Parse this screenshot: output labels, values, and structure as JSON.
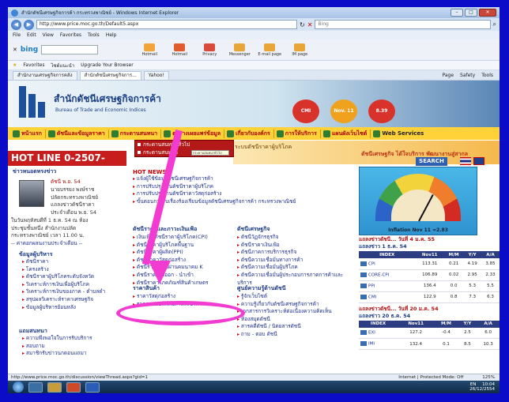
{
  "window": {
    "title": "สำนักดัชนีเศรษฐกิจการค้า กระทรวงพาณิชย์ - Windows Internet Explorer",
    "buttons": {
      "min": "–",
      "max": "□",
      "close": "✕"
    }
  },
  "address": {
    "url": "http://www.price.moc.go.th/Default5.aspx",
    "search_placeholder": "Bing"
  },
  "menu": [
    "File",
    "Edit",
    "View",
    "Favorites",
    "Tools",
    "Help"
  ],
  "bingbar": {
    "label": "bing",
    "tools": [
      "Hotmail",
      "Hotmail",
      "Privacy",
      "Messenger",
      "E-mail page",
      "IM page"
    ]
  },
  "favbar": [
    "Favorites",
    "ไซต์แนะนำ",
    "Upgrade Your Browser"
  ],
  "tabs": [
    "สำนักงานเศรษฐกิจการคลัง",
    "สำนักดัชนีเศรษฐกิจการ...",
    "Yahoo!"
  ],
  "commands": [
    "Page",
    "Safety",
    "Tools"
  ],
  "site": {
    "name_th": "สำนักดัชนีเศรษฐกิจการค้า",
    "name_en": "Bureau of Trade and Economic Indices",
    "circles": [
      "CMI",
      "Nov. 11",
      "8.39"
    ]
  },
  "nav": [
    "หน้าแรก",
    "ดัชนีและข้อมูลราคา",
    "กระดานสนทนา",
    "ตารางเผยแพร่ข้อมูล",
    "เกี่ยวกับองค์กร",
    "การให้บริการ",
    "แผนผังเว็บไซต์",
    "Web Services"
  ],
  "dropdown": [
    "กระดานสนทนาทั่วไป",
    "กระดานสนทนา"
  ],
  "tooltip": "กระดานสนทนาทั่วไป",
  "hotline": "HOT LINE 0-2507-7000",
  "subbanner": {
    "title": "ระบบดัชนีราคาผู้บริโภค",
    "text": "ดัชนีเศรษฐกิจ ได้ใจบริการ พัฒนางานสู่สากล"
  },
  "search_button": "SEARCH",
  "left": {
    "news_title": "ข่าวหนอดทรงข่าว",
    "news_date": "ตัชนี พ.ย. 54",
    "news_lines": [
      "นายบรรยง พงษ์ราช",
      "ปลัดกระทรวงพาณิชย์",
      "แถลงข่าวดัชนีราคา",
      "ประจำเดือน พ.ย. 54",
      "ในวันพฤหัสบดีที่ 1 ธ.ค. 54 ณ ห้อง",
      "ประชุมชั้นหนึ่ง สำนักงานปลัด",
      "กระทรวงพาณิชย์ เวลา 11.00 น.",
      "-- ค่าดอกผลนงานประจำเดือน --"
    ],
    "consumer_title": "ข้อมูลผู้บริหาร",
    "consumer_links": [
      "ดัชนีราคา",
      "โครงสร้าง",
      "ดัชนีราคาผู้บริโภคระดับจังหวัด",
      "วิเคราะห์การเงินเพื่อผู้บริโภค",
      "วิเคราะห์การเงินของภาค - ตำบลดำ",
      "สรุปผลวิเคราะห์ราคาเศรษฐกิจ",
      "ข้อมูลผู้บริหารย้อนหลัง"
    ],
    "board_title": "แถมสนทนา",
    "board_links": [
      "ความพึงพอใจในการรับบริการ",
      "สอบถาม",
      "สมาชิกรับข่าวนกดอนแถมา"
    ]
  },
  "news": {
    "title": "HOT NEWS",
    "items": [
      "แจ้งผู้ใช้ข้อมูลดัชนีเศรษฐกิจการค้า",
      "การปรับปรุงฐานดัชนีราคาผู้บริโภค",
      "การปรับปรุงฐานดัชนีราคาวัสดุก่อสร้าง",
      "ขั้นตอนการรับเรื่องร้องเรียนข้อมูลดัชนีเศรษฐกิจการค้า กระทรวงพาณิชย์"
    ]
  },
  "prices": {
    "title": "ดัชนีราคาและภาวะเงินเฟ้อ",
    "links": [
      "เงินเฟ้อ/ดัชนีราคาผู้บริโภค(CPI)",
      "ดัชนีราคาผู้บริโภคพื้นฐาน",
      "ดัชนีราคาผู้ผลิต(PPI)",
      "ดัชนีราคาวัสดุก่อสร้าง",
      "ดัชนีราคาที่ใช้ผ่านคมนาคม K",
      "ดัชนีราคาส่งออก - นำเข้า",
      "ดัชนีราคาโภคภัณฑ์สินค้าเกษตร"
    ]
  },
  "econ": {
    "title": "ดัชนีเศรษฐกิจ",
    "links": [
      "ดัชนีวัฏจักรธุรกิจ",
      "ดัชนีราคาเงินเฟ้อ",
      "ดัชนีภาคการบริการธุรกิจ",
      "ดัชนีความเชื่อมั่นทางการค้า",
      "ดัชนีความเชื่อมั่นผู้บริโภค",
      "ดัชนีความเชื่อมั่นผู้ประกอบการภาคการค้าและ",
      "บริการ"
    ]
  },
  "goods": {
    "title": "ราคาสินค้า",
    "links": [
      "ราคาวัสดุก่อสร้าง",
      "ราคาขายปลีกสินค้าและบริการ"
    ]
  },
  "center": {
    "title": "ศูนย์ความรู้ด้านดัชนี",
    "links": [
      "รู้จักเว็บไซต์",
      "ความรู้เกี่ยวกับดัชนีเศรษฐกิจการค้า",
      "เอกสารการวิเคราะห์ต่อเนื่องความคิดเห็น",
      "ห้องสมุดดัชนี",
      "สารคดีดัชนี / นิตยสารดัชนี",
      "ถาม - ตอบ ดัชนี"
    ]
  },
  "gauge": {
    "label": "Inflation  Nov 11 =2.83",
    "value": 2.83
  },
  "tables": [
    {
      "heading_red": "แถลงข่าวดัชนี... วันที่ 4 ม.ค. 55",
      "heading": "แถลงข่าว 1 ธ.ค. 54",
      "columns": [
        "INDEX",
        "Nov11",
        "M/M",
        "Y/Y",
        "A/A"
      ],
      "rows": [
        [
          "CPI",
          "113.31",
          "0.21",
          "4.19",
          "3.85"
        ],
        [
          "CORE-CPI",
          "106.89",
          "0.02",
          "2.95",
          "2.33"
        ],
        [
          "PPI",
          "136.4",
          "0.0",
          "5.3",
          "5.5"
        ],
        [
          "CMI",
          "122.9",
          "0.8",
          "7.3",
          "6.3"
        ]
      ]
    },
    {
      "heading_red": "แถลงข่าวดัชนี... วันที่ 20 ม.ค. 54",
      "heading": "แถลงข่าว 20 ธ.ค. 54",
      "columns": [
        "INDEX",
        "Nov11",
        "M/M",
        "Y/Y",
        "A/A"
      ],
      "rows": [
        [
          "EXI",
          "127.2",
          "-0.4",
          "2.5",
          "6.0"
        ],
        [
          "IMI",
          "132.4",
          "0.1",
          "8.5",
          "10.3"
        ]
      ]
    }
  ],
  "status": {
    "url": "http://www.price.moc.go.th/discussion/viewThread.aspx?gid=1",
    "zone": "Internet | Protected Mode: Off",
    "zoom": "125%"
  },
  "taskbar": {
    "lang": "EN",
    "time": "10:04",
    "date": "26/12/2554"
  }
}
